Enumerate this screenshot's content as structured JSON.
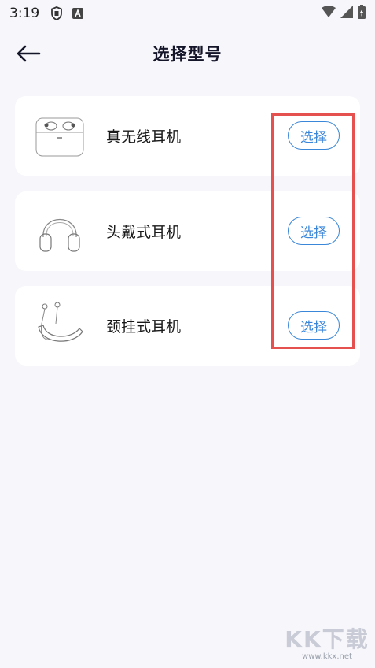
{
  "status_bar": {
    "time": "3:19",
    "icons": [
      "shield-app-icon",
      "font-a-icon"
    ],
    "right_icons": [
      "wifi-icon",
      "signal-icon",
      "battery-charging-icon"
    ]
  },
  "header": {
    "title": "选择型号",
    "back_icon": "arrow-left-icon"
  },
  "models": [
    {
      "name": "真无线耳机",
      "image": "true-wireless-earbuds-case",
      "button_label": "选择"
    },
    {
      "name": "头戴式耳机",
      "image": "over-ear-headphones",
      "button_label": "选择"
    },
    {
      "name": "颈挂式耳机",
      "image": "neckband-earphones",
      "button_label": "选择"
    }
  ],
  "annotation": {
    "color": "#e4514f"
  },
  "colors": {
    "accent": "#3a86d8",
    "background": "#f7f7fb"
  },
  "watermark": {
    "logo": "KK下载",
    "url": "www.kkx.net"
  }
}
